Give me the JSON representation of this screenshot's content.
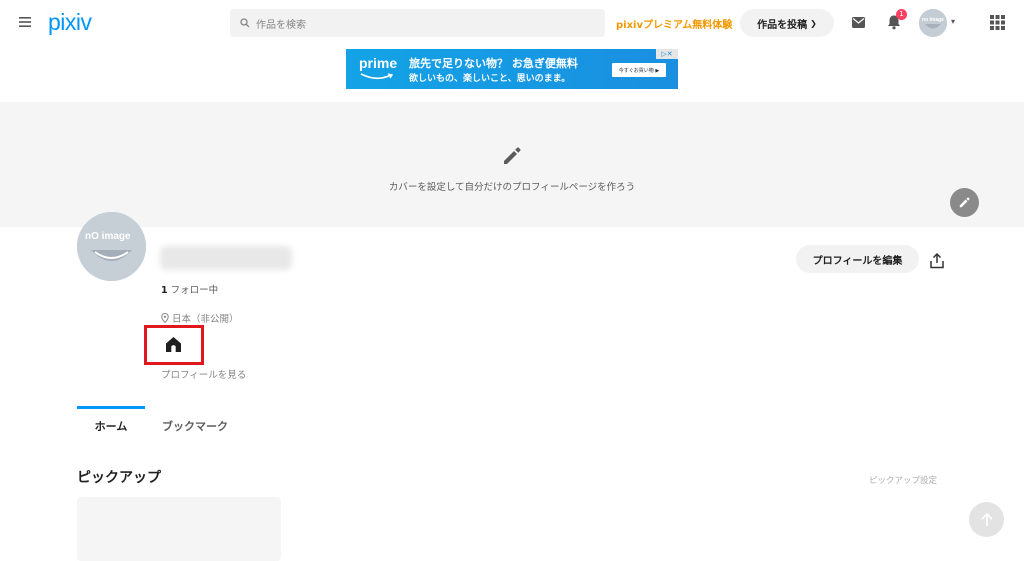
{
  "header": {
    "logo": "pixiv",
    "search_placeholder": "作品を検索",
    "premium_label": "pixivプレミアム無料体験",
    "post_button_label": "作品を投稿",
    "notification_count": "1"
  },
  "ad": {
    "brand": "prime",
    "line1": "旅先で足りない物？ お急ぎ便無料",
    "line2": "欲しいもの、楽しいこと、思いのまま。",
    "button_label": "今すぐお買い物 ▶"
  },
  "cover": {
    "prompt": "カバーを設定して自分だけのプロフィールページを作ろう"
  },
  "profile": {
    "avatar_text": "nO image",
    "following_count": "1",
    "following_label": "フォロー中",
    "location": "日本（非公開）",
    "view_profile": "プロフィールを見る",
    "edit_button": "プロフィールを編集"
  },
  "tabs": [
    {
      "label": "ホーム"
    },
    {
      "label": "ブックマーク"
    }
  ],
  "pickup": {
    "title": "ピックアップ",
    "settings_label": "ピックアップ設定"
  },
  "colors": {
    "brand_blue": "#0096fa",
    "premium_orange": "#f39800",
    "highlight_red": "#e0181c"
  }
}
